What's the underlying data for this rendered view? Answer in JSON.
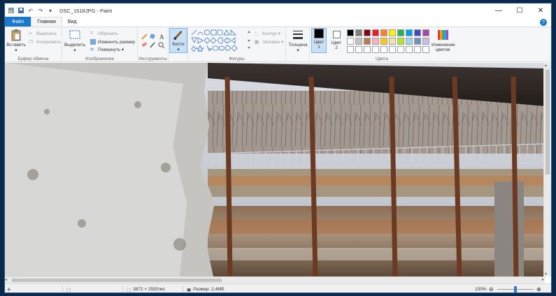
{
  "window": {
    "title": "DSC_1518JPG - Paint",
    "minimize_glyph": "—",
    "maximize_glyph": "☐",
    "close_glyph": "✕"
  },
  "tabs": [
    {
      "label": "Файл"
    },
    {
      "label": "Главная"
    },
    {
      "label": "Вид"
    }
  ],
  "ribbon": {
    "clipboard": {
      "paste": "Вставить",
      "cut": "Вырезать",
      "copy": "Копировать",
      "group": "Буфер обмена"
    },
    "image": {
      "select": "Выделить",
      "crop": "Обрезать",
      "resize": "Изменить размер",
      "rotate": "Повернуть ▾",
      "group": "Изображение"
    },
    "tools": {
      "group": "Инструменты",
      "brushes": "Кисти"
    },
    "shapes": {
      "outline": "Контур ▾",
      "fill": "Заливка ▾",
      "group": "Фигуры"
    },
    "size": {
      "label": "Толщина"
    },
    "colors": {
      "color1": "Цвет 1",
      "color2": "Цвет 2",
      "edit": "Изменение цветов",
      "group": "Цвета",
      "palette_row1": [
        "#000000",
        "#7f7f7f",
        "#880015",
        "#ed1c24",
        "#ff7f27",
        "#fff200",
        "#22b14c",
        "#00a2e8",
        "#3f48cc",
        "#a349a4"
      ],
      "palette_row2": [
        "#ffffff",
        "#c3c3c3",
        "#b97a57",
        "#ffaec9",
        "#ffc90e",
        "#efe4b0",
        "#b5e61d",
        "#99d9ea",
        "#7092be",
        "#c8bfe7"
      ],
      "primary": "#000000",
      "secondary": "#ffffff"
    }
  },
  "status": {
    "dimensions": "3872 × 2592пкс",
    "filesize": "Размер: 2,4МБ",
    "zoom": "100%",
    "zoom_out": "⊖",
    "zoom_in": "⊕"
  }
}
